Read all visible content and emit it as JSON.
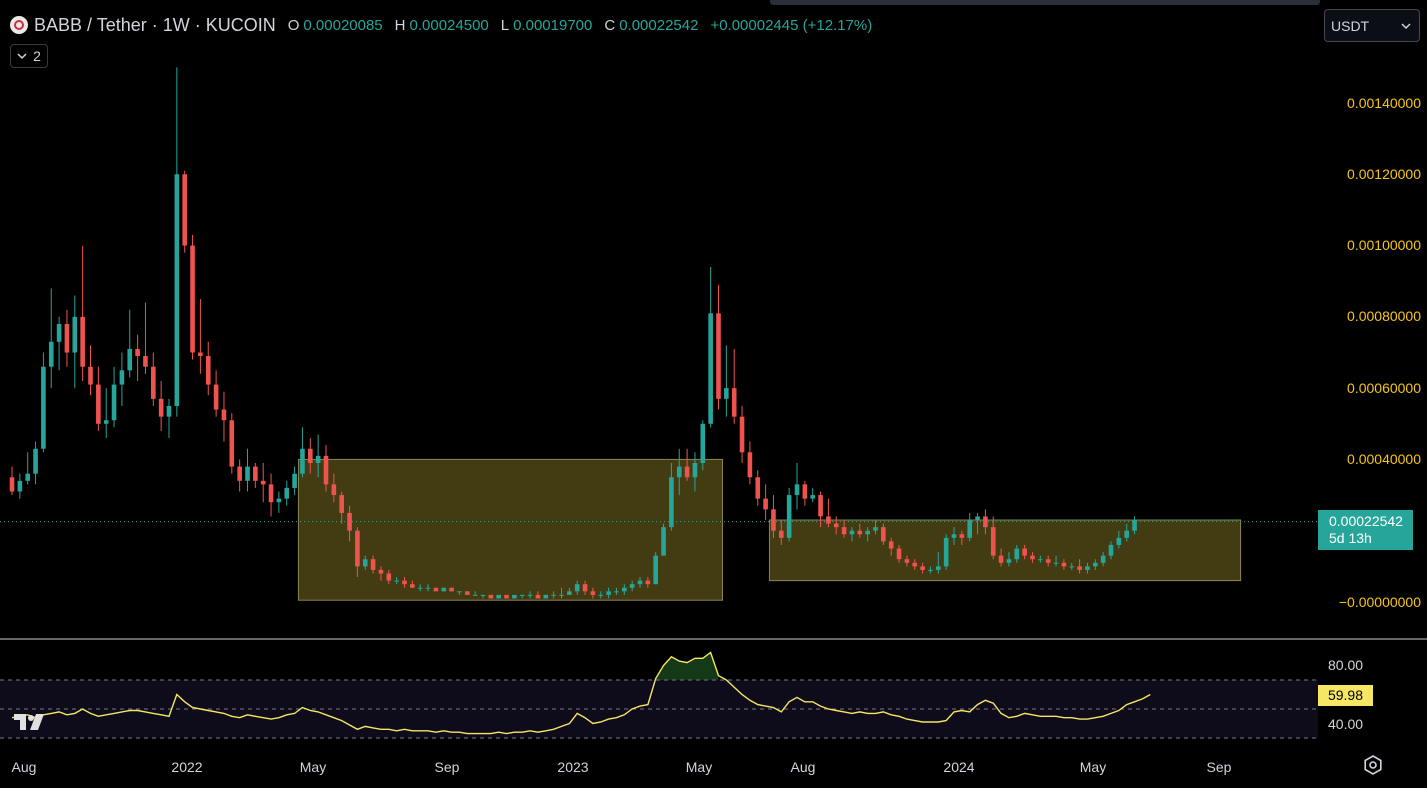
{
  "header": {
    "symbol_pair": "BABB / Tether · 1W · KUCOIN",
    "open_key": "O",
    "open": "0.00020085",
    "high_key": "H",
    "high": "0.00024500",
    "low_key": "L",
    "low": "0.00019700",
    "close_key": "C",
    "close": "0.00022542",
    "change": "+0.00002445 (+12.17%)",
    "indicator_count": "2"
  },
  "currency": {
    "selected": "USDT"
  },
  "price_axis": {
    "labels": [
      "0.00140000",
      "0.00120000",
      "0.00100000",
      "0.00080000",
      "0.00060000",
      "0.00040000",
      "−0.00000000"
    ],
    "last_price": "0.00022542",
    "countdown": "5d 13h"
  },
  "rsi_axis": {
    "labels": [
      "80.00",
      "40.00"
    ],
    "current": "59.98"
  },
  "time_axis": {
    "labels": [
      "Aug",
      "2022",
      "May",
      "Sep",
      "2023",
      "May",
      "Aug",
      "2024",
      "May",
      "Sep"
    ]
  },
  "colors": {
    "up": "#26a69a",
    "down": "#ef5350",
    "axis_text": "#f5c518",
    "rsi_line": "#f5e664",
    "zone_fill": "#4a4214",
    "zone_border": "#8a8455"
  },
  "icons": {
    "logo": "tradingview-logo-icon",
    "settings": "settings-gear-icon",
    "chevron": "chevron-down-icon"
  },
  "chart_data": [
    {
      "type": "candlestick",
      "x_start": "2021-07-05",
      "interval": "1W",
      "ylim": [
        -2e-05,
        0.00155
      ],
      "ohlc": [
        [
          0.00035,
          0.00038,
          0.0003,
          0.00031
        ],
        [
          0.00031,
          0.00036,
          0.00029,
          0.00034
        ],
        [
          0.00034,
          0.00042,
          0.00033,
          0.00036
        ],
        [
          0.00036,
          0.00045,
          0.00033,
          0.00043
        ],
        [
          0.00043,
          0.0007,
          0.00042,
          0.00066
        ],
        [
          0.00066,
          0.00088,
          0.0006,
          0.00073
        ],
        [
          0.00073,
          0.0008,
          0.00065,
          0.00078
        ],
        [
          0.00078,
          0.00082,
          0.00066,
          0.0007
        ],
        [
          0.0007,
          0.00086,
          0.0006,
          0.0008
        ],
        [
          0.0008,
          0.001,
          0.00062,
          0.00066
        ],
        [
          0.00066,
          0.00072,
          0.00058,
          0.00061
        ],
        [
          0.00061,
          0.00066,
          0.00048,
          0.0005
        ],
        [
          0.0005,
          0.0006,
          0.00046,
          0.00051
        ],
        [
          0.00051,
          0.00066,
          0.00049,
          0.00061
        ],
        [
          0.00061,
          0.0007,
          0.00055,
          0.00065
        ],
        [
          0.00065,
          0.00082,
          0.00063,
          0.00071
        ],
        [
          0.00071,
          0.00075,
          0.00062,
          0.00069
        ],
        [
          0.00069,
          0.00084,
          0.00064,
          0.00066
        ],
        [
          0.00066,
          0.0007,
          0.00055,
          0.00057
        ],
        [
          0.00057,
          0.00062,
          0.00048,
          0.00052
        ],
        [
          0.00052,
          0.00057,
          0.00046,
          0.00055
        ],
        [
          0.00055,
          0.0015,
          0.00052,
          0.0012
        ],
        [
          0.0012,
          0.00121,
          0.00098,
          0.001
        ],
        [
          0.001,
          0.00103,
          0.00068,
          0.0007
        ],
        [
          0.0007,
          0.00085,
          0.00064,
          0.00069
        ],
        [
          0.00069,
          0.00073,
          0.00058,
          0.00061
        ],
        [
          0.00061,
          0.00065,
          0.00052,
          0.00054
        ],
        [
          0.00054,
          0.00059,
          0.00045,
          0.00051
        ],
        [
          0.00051,
          0.00053,
          0.00036,
          0.00038
        ],
        [
          0.00038,
          0.0004,
          0.00031,
          0.00034
        ],
        [
          0.00034,
          0.00043,
          0.00031,
          0.00038
        ],
        [
          0.00038,
          0.00039,
          0.00032,
          0.00034
        ],
        [
          0.00034,
          0.00039,
          0.00028,
          0.00033
        ],
        [
          0.00033,
          0.00036,
          0.00024,
          0.00028
        ],
        [
          0.00028,
          0.00031,
          0.00025,
          0.00029
        ],
        [
          0.00029,
          0.00034,
          0.00027,
          0.00032
        ],
        [
          0.00032,
          0.00038,
          0.0003,
          0.00036
        ],
        [
          0.00036,
          0.00049,
          0.00035,
          0.00043
        ],
        [
          0.00043,
          0.00046,
          0.00036,
          0.00039
        ],
        [
          0.00039,
          0.00047,
          0.00035,
          0.00041
        ],
        [
          0.00041,
          0.00044,
          0.00031,
          0.00033
        ],
        [
          0.00033,
          0.00036,
          0.00028,
          0.0003
        ],
        [
          0.0003,
          0.00031,
          0.00022,
          0.00025
        ],
        [
          0.00025,
          0.00027,
          0.00017,
          0.0002
        ],
        [
          0.0002,
          0.00021,
          7e-05,
          0.0001
        ],
        [
          0.0001,
          0.00013,
          9e-05,
          0.00012
        ],
        [
          0.00012,
          0.00013,
          8e-05,
          9e-05
        ],
        [
          9e-05,
          0.0001,
          6e-05,
          8e-05
        ],
        [
          8e-05,
          9e-05,
          5e-05,
          6e-05
        ],
        [
          6e-05,
          7e-05,
          5e-05,
          6e-05
        ],
        [
          6e-05,
          7e-05,
          4e-05,
          5e-05
        ],
        [
          5e-05,
          6e-05,
          4e-05,
          4e-05
        ],
        [
          4e-05,
          5e-05,
          3e-05,
          4e-05
        ],
        [
          4e-05,
          5e-05,
          3e-05,
          4e-05
        ],
        [
          4e-05,
          4e-05,
          3e-05,
          3e-05
        ],
        [
          3e-05,
          4e-05,
          3e-05,
          4e-05
        ],
        [
          4e-05,
          4e-05,
          3e-05,
          3e-05
        ],
        [
          3e-05,
          3e-05,
          2e-05,
          3e-05
        ],
        [
          3e-05,
          3e-05,
          2e-05,
          2e-05
        ],
        [
          2e-05,
          3e-05,
          2e-05,
          2e-05
        ],
        [
          2e-05,
          2e-05,
          1e-05,
          2e-05
        ],
        [
          2e-05,
          2e-05,
          1e-05,
          1e-05
        ],
        [
          1e-05,
          2e-05,
          1e-05,
          2e-05
        ],
        [
          2e-05,
          2e-05,
          1e-05,
          1e-05
        ],
        [
          1e-05,
          2e-05,
          1e-05,
          2e-05
        ],
        [
          2e-05,
          2e-05,
          1e-05,
          2e-05
        ],
        [
          2e-05,
          3e-05,
          1e-05,
          2e-05
        ],
        [
          2e-05,
          3e-05,
          1e-05,
          1e-05
        ],
        [
          1e-05,
          2e-05,
          1e-05,
          2e-05
        ],
        [
          2e-05,
          3e-05,
          1e-05,
          2e-05
        ],
        [
          2e-05,
          4e-05,
          1e-05,
          2e-05
        ],
        [
          2e-05,
          4e-05,
          2e-05,
          3e-05
        ],
        [
          3e-05,
          6e-05,
          2e-05,
          5e-05
        ],
        [
          5e-05,
          6e-05,
          2e-05,
          3e-05
        ],
        [
          3e-05,
          4e-05,
          1e-05,
          2e-05
        ],
        [
          2e-05,
          3e-05,
          1e-05,
          2e-05
        ],
        [
          2e-05,
          4e-05,
          1e-05,
          3e-05
        ],
        [
          3e-05,
          4e-05,
          2e-05,
          3e-05
        ],
        [
          3e-05,
          5e-05,
          2e-05,
          4e-05
        ],
        [
          4e-05,
          6e-05,
          3e-05,
          5e-05
        ],
        [
          5e-05,
          7e-05,
          4e-05,
          6e-05
        ],
        [
          6e-05,
          7e-05,
          4e-05,
          5e-05
        ],
        [
          5e-05,
          0.00014,
          5e-05,
          0.00013
        ],
        [
          0.00013,
          0.00022,
          0.00013,
          0.00021
        ],
        [
          0.00021,
          0.00039,
          0.0002,
          0.00035
        ],
        [
          0.00035,
          0.00043,
          0.0003,
          0.00038
        ],
        [
          0.00038,
          0.00043,
          0.00034,
          0.00035
        ],
        [
          0.00035,
          0.00042,
          0.00031,
          0.00039
        ],
        [
          0.00039,
          0.00051,
          0.00037,
          0.0005
        ],
        [
          0.0005,
          0.00094,
          0.00049,
          0.00081
        ],
        [
          0.00081,
          0.00089,
          0.00054,
          0.00057
        ],
        [
          0.00057,
          0.00072,
          0.00052,
          0.0006
        ],
        [
          0.0006,
          0.00071,
          0.0005,
          0.00052
        ],
        [
          0.00052,
          0.00055,
          0.00039,
          0.00042
        ],
        [
          0.00042,
          0.00045,
          0.00033,
          0.00035
        ],
        [
          0.00035,
          0.00037,
          0.00027,
          0.00029
        ],
        [
          0.00029,
          0.00033,
          0.00023,
          0.00026
        ],
        [
          0.00026,
          0.0003,
          0.00018,
          0.0002
        ],
        [
          0.0002,
          0.00023,
          0.00016,
          0.00018
        ],
        [
          0.00018,
          0.00032,
          0.00017,
          0.0003
        ],
        [
          0.0003,
          0.00039,
          0.00026,
          0.00033
        ],
        [
          0.00033,
          0.00034,
          0.00027,
          0.00029
        ],
        [
          0.00029,
          0.00032,
          0.00028,
          0.0003
        ],
        [
          0.0003,
          0.00031,
          0.00021,
          0.00024
        ],
        [
          0.00024,
          0.00029,
          0.00021,
          0.00022
        ],
        [
          0.00022,
          0.00024,
          0.00019,
          0.00021
        ],
        [
          0.00021,
          0.00023,
          0.00018,
          0.00019
        ],
        [
          0.00019,
          0.00021,
          0.00017,
          0.0002
        ],
        [
          0.0002,
          0.00022,
          0.00018,
          0.00019
        ],
        [
          0.00019,
          0.00021,
          0.00017,
          0.0002
        ],
        [
          0.0002,
          0.00023,
          0.00019,
          0.00021
        ],
        [
          0.00021,
          0.00022,
          0.00016,
          0.00017
        ],
        [
          0.00017,
          0.00018,
          0.00013,
          0.00015
        ],
        [
          0.00015,
          0.00016,
          0.00011,
          0.00012
        ],
        [
          0.00012,
          0.00013,
          0.0001,
          0.00011
        ],
        [
          0.00011,
          0.00012,
          9e-05,
          0.0001
        ],
        [
          0.0001,
          0.00011,
          8e-05,
          9e-05
        ],
        [
          9e-05,
          0.0001,
          8e-05,
          9e-05
        ],
        [
          9e-05,
          0.00014,
          8e-05,
          0.0001
        ],
        [
          0.0001,
          0.00019,
          9e-05,
          0.00018
        ],
        [
          0.00018,
          0.00021,
          0.00016,
          0.00019
        ],
        [
          0.00019,
          0.0002,
          0.00016,
          0.00018
        ],
        [
          0.00018,
          0.00025,
          0.00017,
          0.00023
        ],
        [
          0.00023,
          0.00025,
          0.00019,
          0.00024
        ],
        [
          0.00024,
          0.00026,
          0.00019,
          0.00021
        ],
        [
          0.00021,
          0.00024,
          0.00012,
          0.00013
        ],
        [
          0.00013,
          0.00015,
          0.0001,
          0.00011
        ],
        [
          0.00011,
          0.00014,
          0.0001,
          0.00012
        ],
        [
          0.00012,
          0.00016,
          0.00011,
          0.00015
        ],
        [
          0.00015,
          0.00016,
          0.00012,
          0.00013
        ],
        [
          0.00013,
          0.00014,
          0.00011,
          0.00012
        ],
        [
          0.00012,
          0.00013,
          0.00011,
          0.00012
        ],
        [
          0.00012,
          0.00013,
          0.0001,
          0.00011
        ],
        [
          0.00011,
          0.00013,
          0.0001,
          0.00011
        ],
        [
          0.00011,
          0.00012,
          9e-05,
          0.0001
        ],
        [
          0.0001,
          0.00011,
          9e-05,
          0.0001
        ],
        [
          0.0001,
          0.00012,
          8e-05,
          9e-05
        ],
        [
          9e-05,
          0.00011,
          8e-05,
          0.0001
        ],
        [
          0.0001,
          0.00012,
          9e-05,
          0.00011
        ],
        [
          0.00011,
          0.00014,
          0.0001,
          0.00013
        ],
        [
          0.00013,
          0.00017,
          0.00012,
          0.00016
        ],
        [
          0.00016,
          0.0002,
          0.00015,
          0.00018
        ],
        [
          0.00018,
          0.00022,
          0.00017,
          0.0002
        ],
        [
          0.0002,
          0.00024,
          0.00019,
          0.00023
        ]
      ],
      "zones": [
        {
          "start_week": 37,
          "end_week": 90,
          "top": 0.0004,
          "bottom": 5e-06
        },
        {
          "start_week": 97,
          "end_week": 156,
          "top": 0.00023,
          "bottom": 6e-05
        }
      ],
      "last_price_line": 0.00022542
    },
    {
      "type": "line",
      "name": "RSI",
      "ylim": [
        30,
        95
      ],
      "bands": [
        70,
        50,
        30
      ],
      "values": [
        44,
        45,
        46,
        44,
        46,
        47,
        48,
        46,
        47,
        50,
        47,
        45,
        46,
        47,
        48,
        49,
        49,
        48,
        47,
        46,
        45,
        60,
        55,
        51,
        50,
        49,
        48,
        47,
        45,
        44,
        46,
        45,
        44,
        43,
        44,
        46,
        47,
        51,
        49,
        48,
        46,
        44,
        42,
        39,
        36,
        38,
        37,
        36,
        36,
        35,
        36,
        35,
        35,
        35,
        34,
        35,
        34,
        34,
        33,
        33,
        33,
        33,
        34,
        33,
        34,
        34,
        35,
        34,
        35,
        36,
        38,
        40,
        47,
        44,
        40,
        41,
        43,
        44,
        46,
        50,
        52,
        53,
        71,
        80,
        86,
        83,
        82,
        85,
        85,
        89,
        73,
        70,
        65,
        60,
        56,
        53,
        52,
        51,
        48,
        55,
        58,
        55,
        55,
        52,
        50,
        49,
        48,
        47,
        48,
        47,
        47,
        48,
        46,
        45,
        43,
        42,
        41,
        41,
        41,
        42,
        48,
        49,
        48,
        53,
        56,
        54,
        47,
        44,
        45,
        47,
        46,
        45,
        45,
        45,
        44,
        44,
        43,
        43,
        44,
        45,
        47,
        49,
        53,
        55,
        57,
        60
      ]
    }
  ]
}
